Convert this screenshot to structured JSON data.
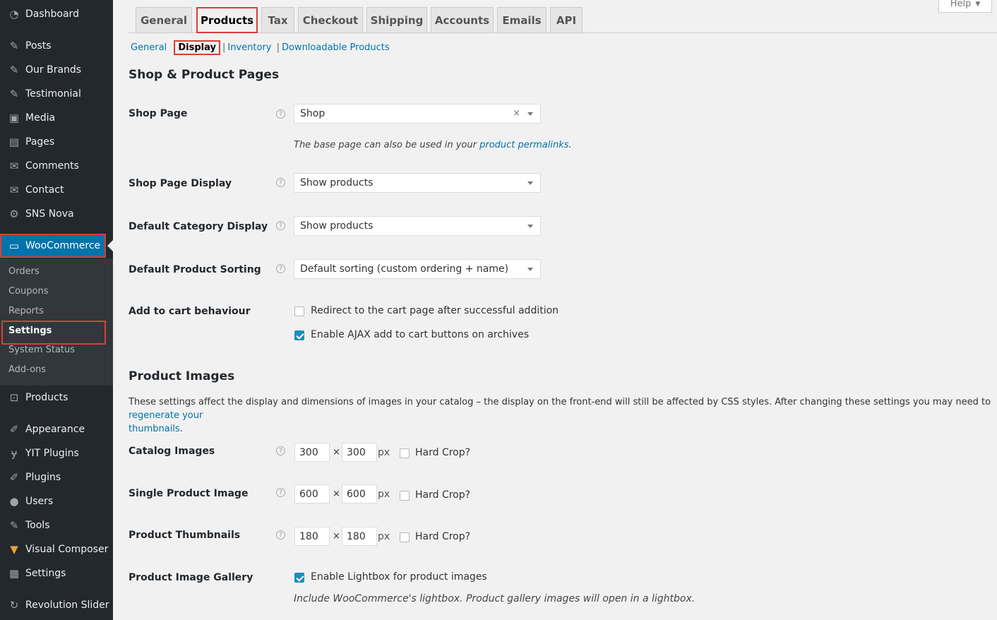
{
  "sidebar": {
    "items": [
      {
        "label": "Dashboard",
        "icon": "dashboard-icon",
        "glyph": "◔"
      },
      {
        "label": "Posts",
        "icon": "pin-icon",
        "glyph": "✎"
      },
      {
        "label": "Our Brands",
        "icon": "pin-icon",
        "glyph": "✎"
      },
      {
        "label": "Testimonial",
        "icon": "pin-icon",
        "glyph": "✎"
      },
      {
        "label": "Media",
        "icon": "media-icon",
        "glyph": "▣"
      },
      {
        "label": "Pages",
        "icon": "pages-icon",
        "glyph": "▤"
      },
      {
        "label": "Comments",
        "icon": "comment-icon",
        "glyph": "✉"
      },
      {
        "label": "Contact",
        "icon": "envelope-icon",
        "glyph": "✉"
      },
      {
        "label": "SNS Nova",
        "icon": "gear-icon",
        "glyph": "⚙"
      },
      {
        "label": "WooCommerce",
        "icon": "woo-icon",
        "glyph": "▭"
      }
    ],
    "submenu": [
      "Orders",
      "Coupons",
      "Reports",
      "Settings",
      "System Status",
      "Add-ons"
    ],
    "items_after": [
      {
        "label": "Products",
        "icon": "cart-icon",
        "glyph": "⊡"
      },
      {
        "label": "Appearance",
        "icon": "brush-icon",
        "glyph": "✐"
      },
      {
        "label": "YIT Plugins",
        "icon": "plugin-icon",
        "glyph": "ɏ"
      },
      {
        "label": "Plugins",
        "icon": "plug-icon",
        "glyph": "✐"
      },
      {
        "label": "Users",
        "icon": "user-icon",
        "glyph": "●"
      },
      {
        "label": "Tools",
        "icon": "wrench-icon",
        "glyph": "✎"
      },
      {
        "label": "Visual Composer",
        "icon": "vc-icon",
        "glyph": "▼"
      },
      {
        "label": "Settings",
        "icon": "settings-icon",
        "glyph": "▦"
      },
      {
        "label": "Revolution Slider",
        "icon": "refresh-icon",
        "glyph": "↻"
      }
    ]
  },
  "help": {
    "label": "Help"
  },
  "tabs": [
    "General",
    "Products",
    "Tax",
    "Checkout",
    "Shipping",
    "Accounts",
    "Emails",
    "API"
  ],
  "subtabs": {
    "general": "General",
    "display": "Display",
    "inventory": "Inventory",
    "downloadable": "Downloadable Products"
  },
  "shop_section": {
    "title": "Shop & Product Pages",
    "shop_page": {
      "label": "Shop Page",
      "value": "Shop",
      "clear": "×"
    },
    "shop_page_desc": {
      "text": "The base page can also be used in your ",
      "link": "product permalinks",
      "end": "."
    },
    "shop_page_display": {
      "label": "Shop Page Display",
      "value": "Show products"
    },
    "category_display": {
      "label": "Default Category Display",
      "value": "Show products"
    },
    "sorting": {
      "label": "Default Product Sorting",
      "value": "Default sorting (custom ordering + name)"
    },
    "add_to_cart": {
      "label": "Add to cart behaviour",
      "redirect": "Redirect to the cart page after successful addition",
      "ajax": "Enable AJAX add to cart buttons on archives"
    }
  },
  "images_section": {
    "title": "Product Images",
    "desc": "These settings affect the display and dimensions of images in your catalog – the display on the front-end will still be affected by CSS styles. After changing these settings you may need to ",
    "desc_link_1": "regenerate your",
    "desc_link_2": "thumbnails",
    "desc_end": ".",
    "times": "×",
    "px": "px",
    "hard_crop": "Hard Crop?",
    "catalog": {
      "label": "Catalog Images",
      "width": "300",
      "height": "300"
    },
    "single": {
      "label": "Single Product Image",
      "width": "600",
      "height": "600"
    },
    "thumbs": {
      "label": "Product Thumbnails",
      "width": "180",
      "height": "180"
    },
    "gallery": {
      "label": "Product Image Gallery",
      "checkbox": "Enable Lightbox for product images",
      "desc": "Include WooCommerce's lightbox. Product gallery images will open in a lightbox."
    }
  },
  "colors": {
    "accent": "#0073aa",
    "highlight": "#dd3d36",
    "sidebar": "#23282d"
  }
}
